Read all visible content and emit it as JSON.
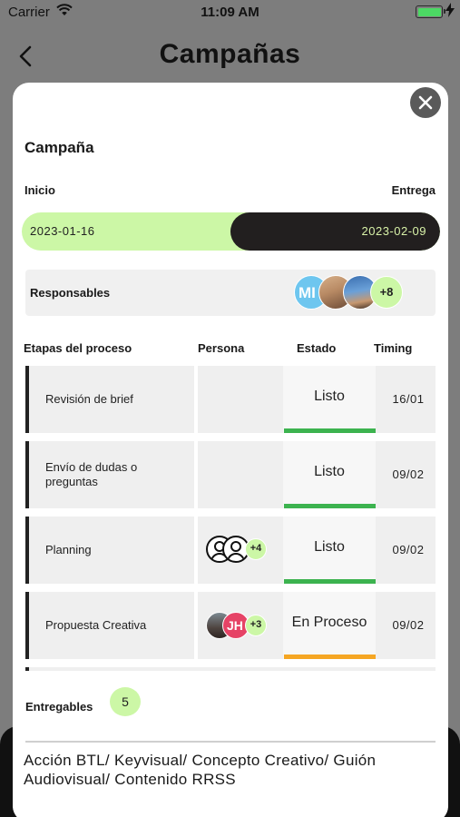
{
  "status_bar": {
    "carrier": "Carrier",
    "time": "11:09 AM"
  },
  "nav": {
    "title": "Campañas"
  },
  "modal": {
    "section_title": "Campaña",
    "start_label": "Inicio",
    "end_label": "Entrega",
    "start_date": "2023-01-16",
    "end_date": "2023-02-09",
    "responsables": {
      "label": "Responsables",
      "avatar_initials": "MI",
      "more_count": "+8"
    },
    "table": {
      "headers": [
        "Etapas del proceso",
        "Persona",
        "Estado",
        "Timing"
      ],
      "rows": [
        {
          "etapa": "Revisión de brief",
          "estado": "Listo",
          "timing": "16/01",
          "status_color": "#3cb34f"
        },
        {
          "etapa": "Envío de dudas o preguntas",
          "estado": "Listo",
          "timing": "09/02",
          "status_color": "#3cb34f"
        },
        {
          "etapa": "Planning",
          "estado": "Listo",
          "timing": "09/02",
          "status_color": "#3cb34f",
          "persona_more": "+4"
        },
        {
          "etapa": "Propuesta Creativa",
          "estado": "En Proceso",
          "timing": "09/02",
          "status_color": "#f5a623",
          "persona_initials": "JH",
          "persona_more": "+3"
        }
      ]
    },
    "entregables": {
      "label": "Entregables",
      "count": "5",
      "description": "Acción BTL/ Keyvisual/ Concepto Creativo/ Guión Audiovisual/ Contenido RRSS"
    }
  },
  "colors": {
    "accent_green": "#ccf7a6",
    "dark": "#221f1f",
    "done": "#3cb34f",
    "in_progress": "#f5a623"
  },
  "icons": [
    "wifi-icon",
    "battery-icon",
    "charging-bolt-icon",
    "back-chevron-icon",
    "close-icon",
    "user-placeholder-icon"
  ]
}
